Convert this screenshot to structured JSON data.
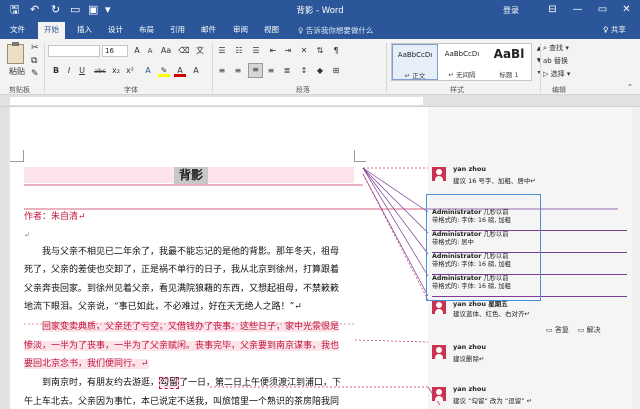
{
  "window": {
    "title": "背影 - Word",
    "login": "登录"
  },
  "quick_access": {
    "save": "🖫",
    "undo": "↶",
    "redo": "↻",
    "new_doc": "▭",
    "open": "▣",
    "more": "▾"
  },
  "window_controls": {
    "ribbon_options": "⊟",
    "minimize": "—",
    "maximize": "▭",
    "close": "✕"
  },
  "tabs": [
    "文件",
    "开始",
    "插入",
    "设计",
    "布局",
    "引用",
    "邮件",
    "审阅",
    "视图"
  ],
  "tell_me": "♀ 告诉我你想要做什么",
  "share": "♀ 共享",
  "ribbon": {
    "paste_label": "粘贴",
    "clipboard_label": "剪贴板",
    "font_label": "字体",
    "paragraph_label": "段落",
    "styles_label": "样式",
    "editing_label": "编辑",
    "font_name": "",
    "font_size": "16",
    "font_buttons": [
      "B",
      "I",
      "U",
      "abc",
      "x₂",
      "x²",
      "A"
    ],
    "styles": [
      {
        "sample": "AaBbCcDı",
        "name": "↵ 正文"
      },
      {
        "sample": "AaBbCcDı",
        "name": "↵ 无间隔"
      },
      {
        "sample": "AaBl",
        "name": "标题 1"
      }
    ],
    "edit_items": [
      "⌕ 查找 ▾",
      "ab 替换",
      "▷ 选择 ▾"
    ]
  },
  "document": {
    "heading": "背影",
    "author_line": "作者：朱自清↵",
    "empty_mark": "↵",
    "para1": [
      "我与父亲不相见已二年余了，我最不能忘记的是他的背影。那年冬天，祖母",
      "死了，父亲的差使也交卸了，正是祸不单行的日子，我从北京到徐州，打算跟着",
      "父亲奔丧回家。到徐州见着父亲，看见满院狼藉的东西，又想起祖母，不禁簌簌",
      "地流下眼泪。父亲说，“事已如此，不必难过，好在天无绝人之路！”↵"
    ],
    "para2": [
      "回家变卖典质，父亲还了亏空，又借钱办了丧事。这些日子，家中光景很是",
      "惨淡，一半为了丧事，一半为了父亲赋闲。丧事完毕，父亲要到南京谋事，我也",
      "要回北京念书，我们便同行。↵"
    ],
    "para3": [
      "到南京时，有朋友约去游逛，",
      "勾留",
      "了一日，第二日上午便须渡江到浦口，下",
      "午上车北去。父亲因为事忙，本已说定不送我，叫旅馆里一个熟识的茶房陪我同"
    ]
  },
  "comments": [
    {
      "author": "yan zhou",
      "text": "建议 16 号字、加粗、居中↵"
    },
    {
      "author": "yan zhou 星期五",
      "text": "建议蓝体、红色、右对齐↵"
    },
    {
      "author": "yan zhou",
      "text": "建议删除↵"
    },
    {
      "author": "yan zhou",
      "text": "建议 “勾留” 改为 “逗留” ↵"
    }
  ],
  "format_changes": [
    {
      "author": "Administrator",
      "time": "几秒以前",
      "text": "带格式的: 字体: 16 磅, 加粗"
    },
    {
      "author": "Administrator",
      "time": "几秒以前",
      "text": "带格式的: 居中"
    },
    {
      "author": "Administrator",
      "time": "几秒以前",
      "text": "带格式的: 字体: 16 磅, 加粗"
    },
    {
      "author": "Administrator",
      "time": "几秒以前",
      "text": "带格式的: 字体: 16 磅, 加粗"
    }
  ],
  "reply_actions": {
    "reply": "答复",
    "resolve": "解决"
  }
}
